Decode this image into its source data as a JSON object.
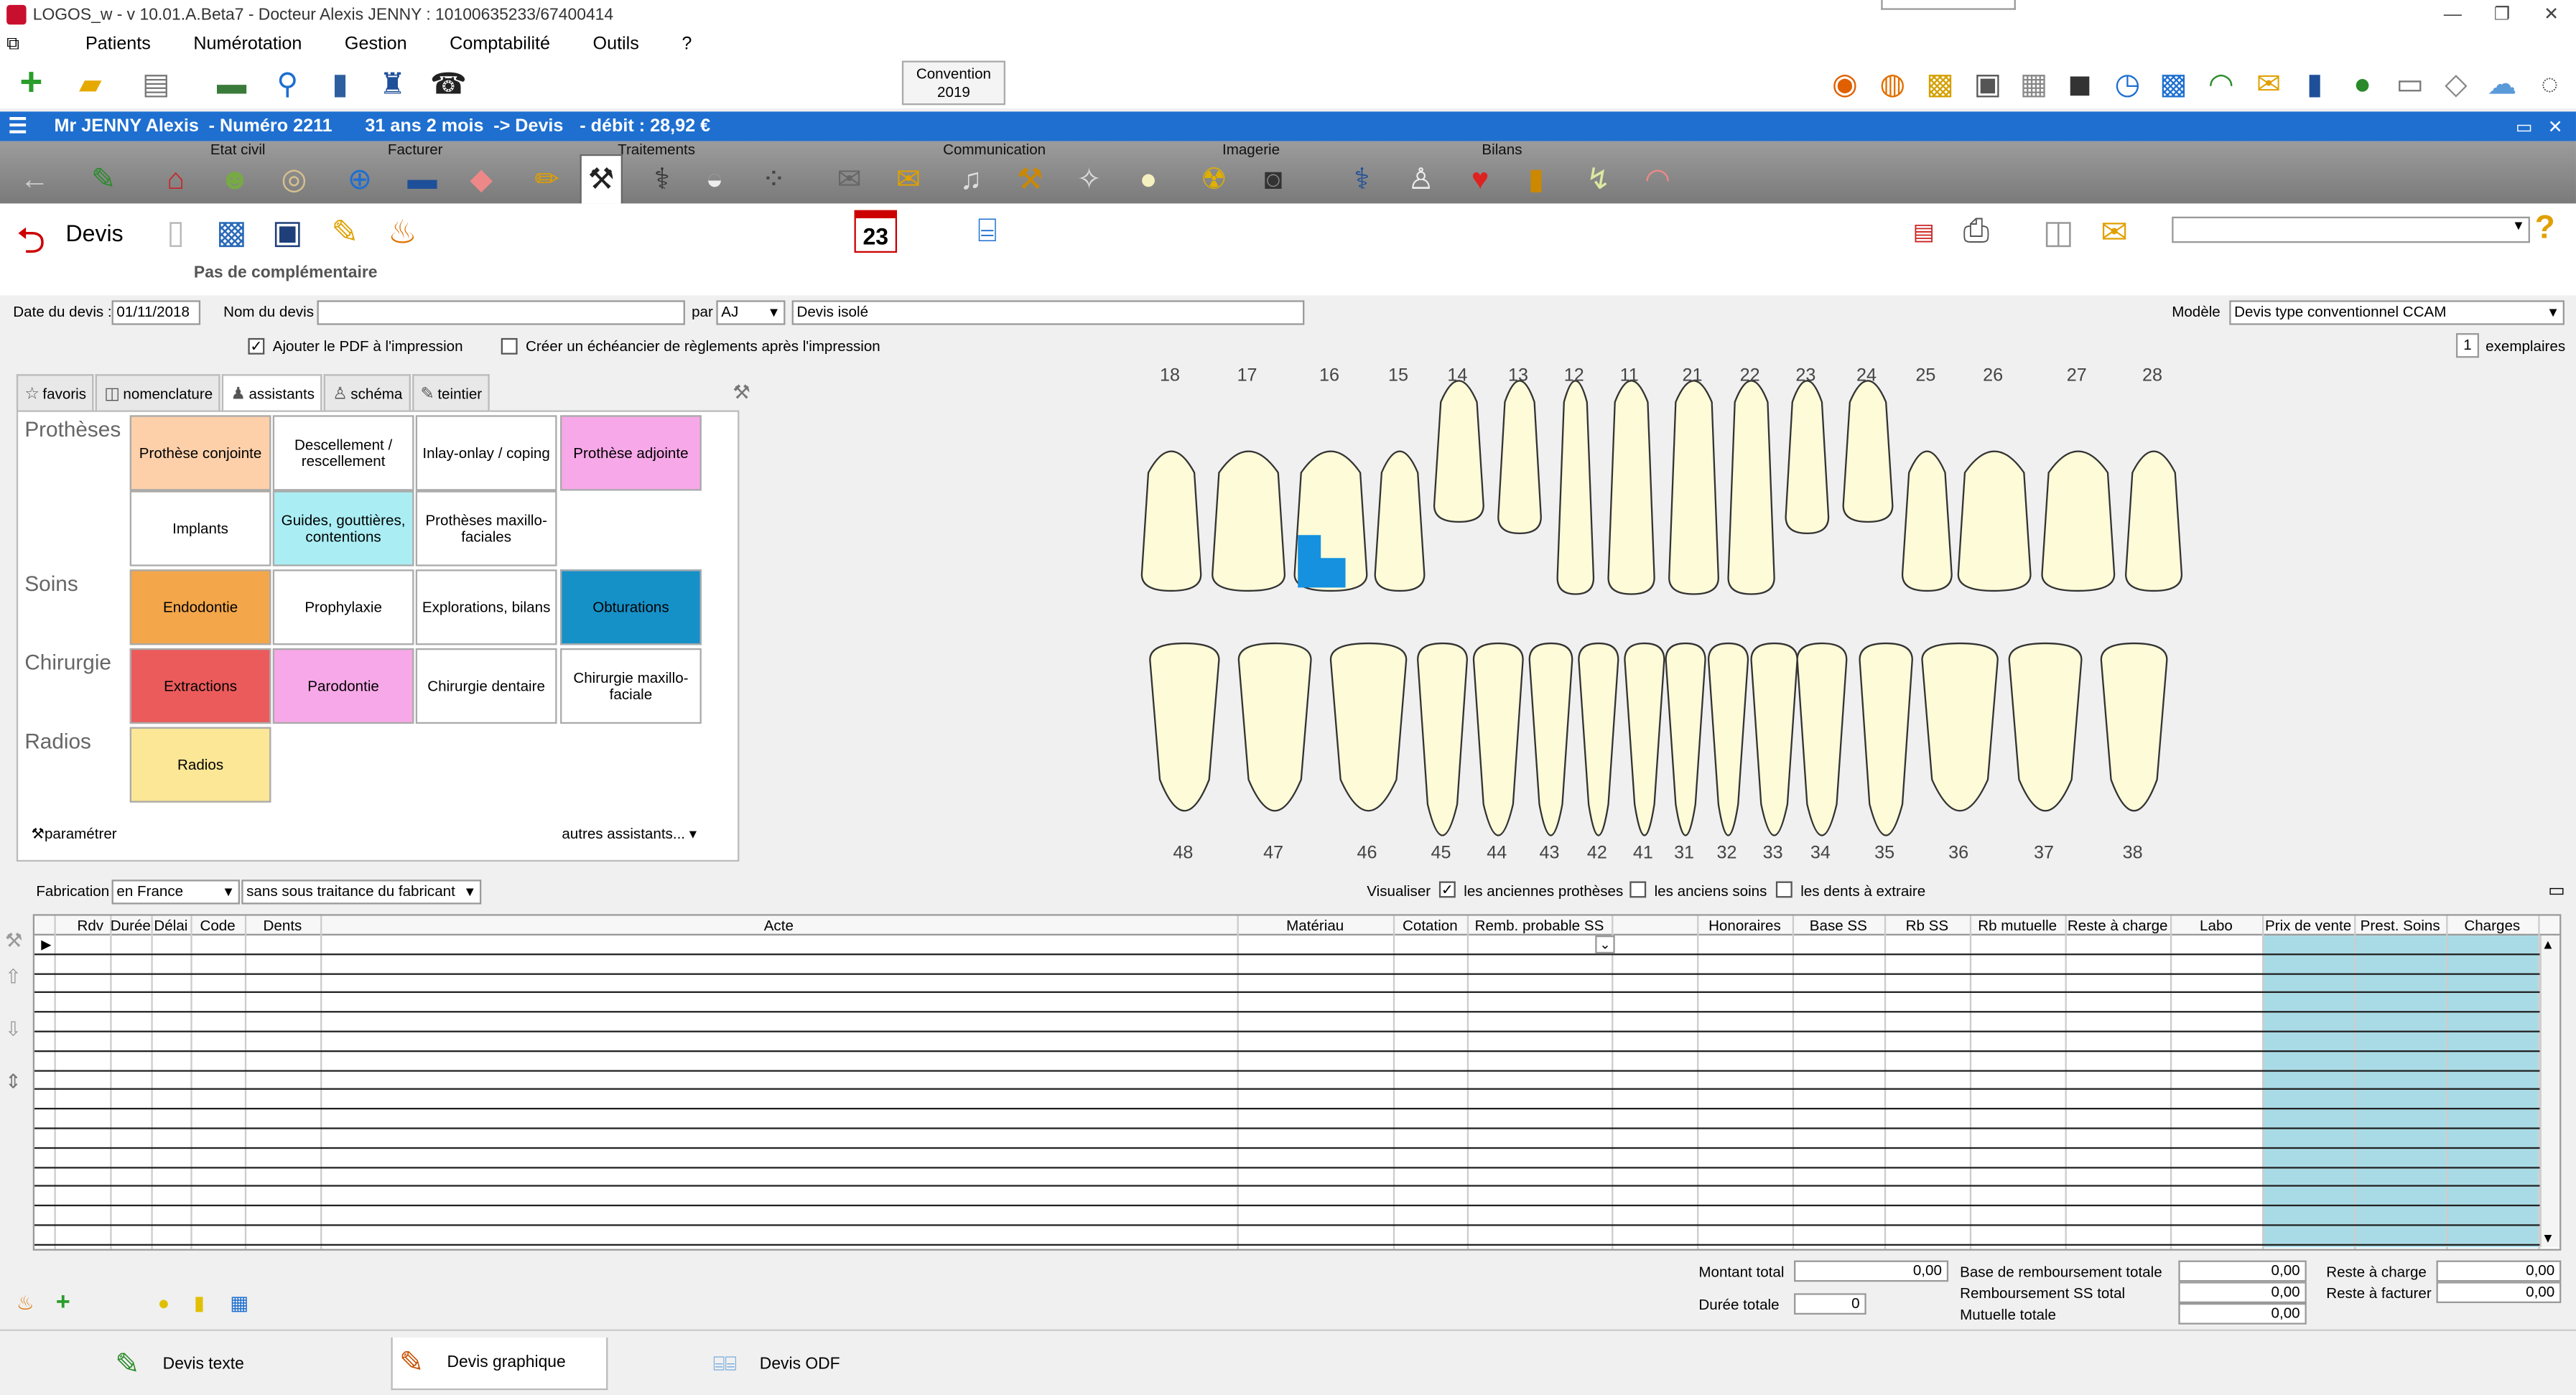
{
  "window": {
    "title": "LOGOS_w - v 10.01.A.Beta7  -  Docteur Alexis JENNY : 10100635233/67400414"
  },
  "menu": [
    "Patients",
    "Numérotation",
    "Gestion",
    "Comptabilité",
    "Outils",
    "?"
  ],
  "convention": {
    "line1": "Convention",
    "line2": "2019"
  },
  "patient": {
    "name": "Mr JENNY Alexis",
    "number": "-  Numéro 2211",
    "age": "31 ans 2 mois",
    "module": "->  Devis",
    "debit": "-  débit : 28,92 €"
  },
  "module_groups": [
    "Etat civil",
    "Facturer",
    "Traitements",
    "Communication",
    "Imagerie",
    "Bilans"
  ],
  "devis": {
    "title": "Devis",
    "no_complement": "Pas de complémentaire",
    "calendar_day": "23"
  },
  "form": {
    "date_label": "Date du devis :",
    "date_value": "01/11/2018",
    "name_label": "Nom du devis",
    "name_value": "",
    "par_label": "par",
    "par_value": "AJ",
    "devis_type": "Devis isolé",
    "modele_label": "Modèle",
    "modele_value": "Devis type conventionnel CCAM",
    "pdf_checkbox": "Ajouter le PDF à l'impression",
    "echeancier_checkbox": "Créer un échéancier de règlements après l'impression",
    "copies_value": "1",
    "copies_label": "exemplaires"
  },
  "assistant": {
    "tabs": [
      "favoris",
      "nomenclature",
      "assistants",
      "schéma",
      "teintier"
    ],
    "categories": [
      "Prothèses",
      "Soins",
      "Chirurgie",
      "Radios"
    ],
    "buttons": [
      {
        "label": "Prothèse conjointe",
        "color": "#fdd0aa"
      },
      {
        "label": "Descellement / rescellement",
        "color": "#ffffff"
      },
      {
        "label": "Inlay-onlay / coping",
        "color": "#ffffff"
      },
      {
        "label": "Prothèse adjointe",
        "color": "#f7a8e8"
      },
      {
        "label": "Implants",
        "color": "#ffffff"
      },
      {
        "label": "Guides, gouttières, contentions",
        "color": "#aaeef4"
      },
      {
        "label": "Prothèses maxillo-faciales",
        "color": "#ffffff"
      },
      {
        "label": "Endodontie",
        "color": "#f3a64a"
      },
      {
        "label": "Prophylaxie",
        "color": "#ffffff"
      },
      {
        "label": "Explorations, bilans",
        "color": "#ffffff"
      },
      {
        "label": "Obturations",
        "color": "#1591c8"
      },
      {
        "label": "Extractions",
        "color": "#ec5b5b"
      },
      {
        "label": "Parodontie",
        "color": "#f7a8e8"
      },
      {
        "label": "Chirurgie dentaire",
        "color": "#ffffff"
      },
      {
        "label": "Chirurgie maxillo-faciale",
        "color": "#ffffff"
      },
      {
        "label": "Radios",
        "color": "#fbe796"
      }
    ],
    "parametrer": "paramétrer",
    "autres": "autres assistants..."
  },
  "teeth": {
    "upper": [
      "18",
      "17",
      "16",
      "15",
      "14",
      "13",
      "12",
      "11",
      "21",
      "22",
      "23",
      "24",
      "25",
      "26",
      "27",
      "28"
    ],
    "lower": [
      "48",
      "47",
      "46",
      "45",
      "44",
      "43",
      "42",
      "41",
      "31",
      "32",
      "33",
      "34",
      "35",
      "36",
      "37",
      "38"
    ]
  },
  "fabrication": {
    "label": "Fabrication",
    "origin": "en France",
    "traitance": "sans sous traitance du fabricant",
    "visualiser": "Visualiser",
    "opt1": "les anciennes prothèses",
    "opt2": "les anciens soins",
    "opt3": "les dents à extraire"
  },
  "grid": {
    "columns": [
      "Rdv",
      "Durée",
      "Délai",
      "Code",
      "Dents",
      "Acte",
      "Matériau",
      "Cotation",
      "Remb. probable SS",
      "Honoraires",
      "Base SS",
      "Rb SS",
      "Rb mutuelle",
      "Reste à charge",
      "Labo",
      "Prix de vente",
      "Prest. Soins",
      "Charges"
    ]
  },
  "totals": {
    "montant_label": "Montant total",
    "montant_value": "0,00",
    "duree_label": "Durée totale",
    "duree_value": "0",
    "base_label": "Base de remboursement totale",
    "base_value": "0,00",
    "rss_label": "Remboursement SS total",
    "rss_value": "0,00",
    "mut_label": "Mutuelle totale",
    "mut_value": "0,00",
    "reste_label": "Reste à charge",
    "reste_value": "0,00",
    "facturer_label": "Reste à facturer",
    "facturer_value": "0,00"
  },
  "bottom_tabs": [
    "Devis texte",
    "Devis graphique",
    "Devis ODF"
  ]
}
